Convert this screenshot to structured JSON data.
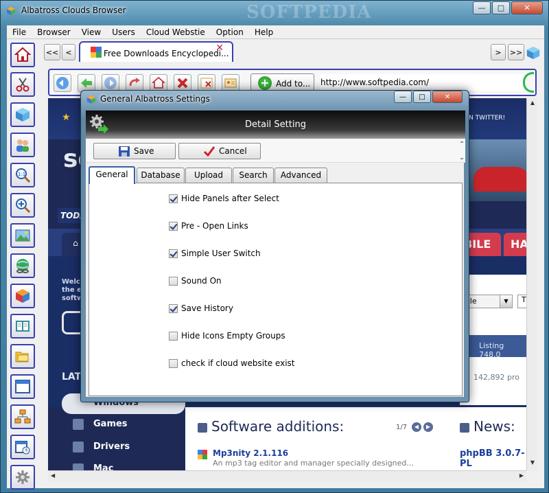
{
  "window": {
    "title": "Albatross Clouds Browser",
    "watermark": "SOFTPEDIA",
    "controls": {
      "minimize": "—",
      "maximize": "□",
      "close": "✕"
    }
  },
  "menu": [
    "File",
    "Browser",
    "View",
    "Users",
    "Cloud Webstie",
    "Option",
    "Help"
  ],
  "left_toolbar": [
    "home-icon",
    "scissors-icon",
    "cube-icon",
    "users-icon",
    "zoom-actual-icon",
    "zoom-in-icon",
    "picture-icon",
    "globe-link-icon",
    "colorful-cube-icon",
    "book-icon",
    "folders-icon",
    "window-icon",
    "sitemap-icon",
    "calendar-clock-icon",
    "settings-icon"
  ],
  "tabbar": {
    "first": "<<",
    "prev": "<",
    "next": ">",
    "last": ">>",
    "active_tab": "Free Downloads Encyclopedi..."
  },
  "address": {
    "add_to_label": "Add to...",
    "url": "http://www.softpedia.com/"
  },
  "webpage": {
    "twitter": "ON TWITTER!",
    "logo": "so",
    "today": "TODA",
    "bile": "BILE",
    "ha": "HA",
    "welcome_lines": [
      "Welco",
      "the e",
      "softw"
    ],
    "select_value": "ele",
    "t_value": "T",
    "listing": "Listing 748,0",
    "count": "142,892 pro",
    "latest": "LAT",
    "windows": "Windows",
    "games": "Games",
    "drivers": "Drivers",
    "mac": "Mac",
    "software_additions": "Software additions:",
    "page": "1/7",
    "news": "News:",
    "item_title": "Mp3nity 2.1.116",
    "item_desc": "An mp3 tag editor and manager specially designed...",
    "news_item": "phpBB 3.0.7-PL"
  },
  "dialog": {
    "title": "General Albatross Settings",
    "header": "Detail Setting",
    "save_label": "Save",
    "cancel_label": "Cancel",
    "tabs": [
      "General",
      "Database",
      "Upload",
      "Search",
      "Advanced"
    ],
    "active_tab": "General",
    "options": [
      {
        "label": "Hide Panels after Select",
        "checked": true
      },
      {
        "label": "Pre - Open Links",
        "checked": true
      },
      {
        "label": "Simple User Switch",
        "checked": true
      },
      {
        "label": "Sound On",
        "checked": false
      },
      {
        "label": "Save History",
        "checked": true
      },
      {
        "label": "Hide Icons Empty Groups",
        "checked": false
      },
      {
        "label": "check if cloud website exist",
        "checked": false
      }
    ]
  }
}
